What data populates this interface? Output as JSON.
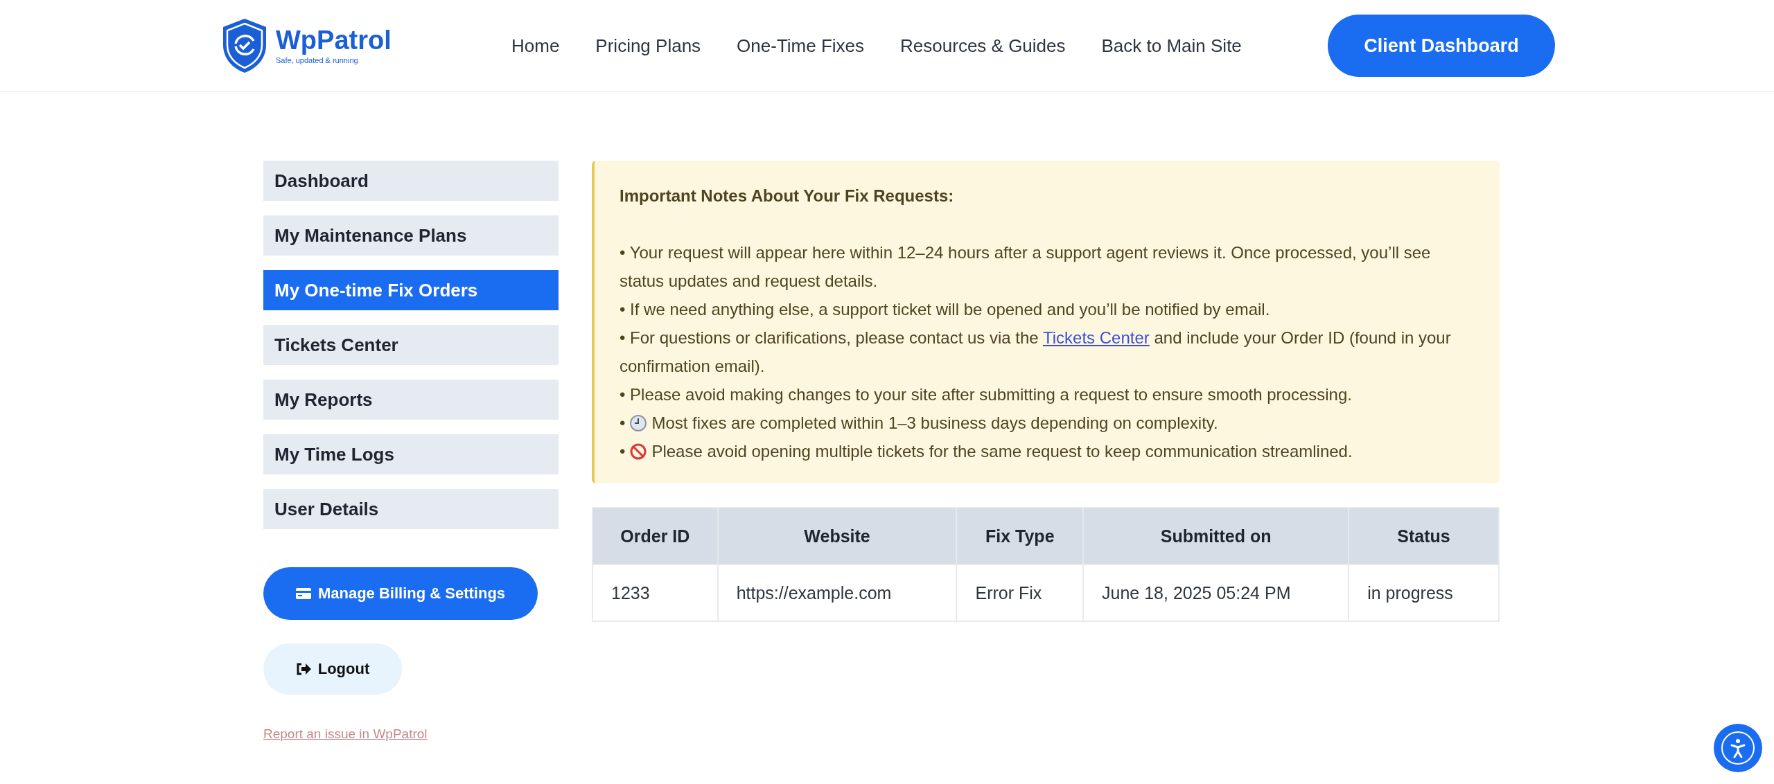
{
  "header": {
    "logo": {
      "name": "WpPatrol",
      "tagline": "Safe, updated & running"
    },
    "nav": [
      "Home",
      "Pricing Plans",
      "One-Time Fixes",
      "Resources & Guides",
      "Back to Main Site"
    ],
    "cta": "Client Dashboard"
  },
  "sidebar": {
    "items": [
      {
        "label": "Dashboard",
        "selected": false
      },
      {
        "label": "My Maintenance Plans",
        "selected": false
      },
      {
        "label": "My One-time Fix Orders",
        "selected": true
      },
      {
        "label": "Tickets Center",
        "selected": false
      },
      {
        "label": "My Reports",
        "selected": false
      },
      {
        "label": "My Time Logs",
        "selected": false
      },
      {
        "label": "User Details",
        "selected": false
      }
    ],
    "billing_button": "Manage Billing & Settings",
    "logout_button": "Logout",
    "report_link": "Report an issue in WpPatrol"
  },
  "notes": {
    "title": "Important Notes About Your Fix Requests:",
    "items": [
      {
        "text": "• Your request will appear here within 12–24 hours after a support agent reviews it. Once processed, you’ll see status updates and request details."
      },
      {
        "text": "• If we need anything else, a support ticket will be opened and you’ll be notified by email."
      },
      {
        "text": "• For questions or clarifications, please contact us via the ",
        "link": "Tickets Center",
        "after": " and include your Order ID (found in your confirmation email)."
      },
      {
        "text": "• Please avoid making changes to your site after submitting a request to ensure smooth processing."
      },
      {
        "bullet": "•",
        "kind": "clock",
        "text": "Most fixes are completed within 1–3 business days depending on complexity."
      },
      {
        "bullet": "•",
        "kind": "prohibited",
        "text": "Please avoid opening multiple tickets for the same request to keep communication streamlined."
      }
    ]
  },
  "table": {
    "columns": [
      "Order ID",
      "Website",
      "Fix Type",
      "Submitted on",
      "Status"
    ],
    "rows": [
      [
        "1233",
        "https://example.com",
        "Error Fix",
        "June 18, 2025 05:24 PM",
        "in progress"
      ]
    ]
  }
}
